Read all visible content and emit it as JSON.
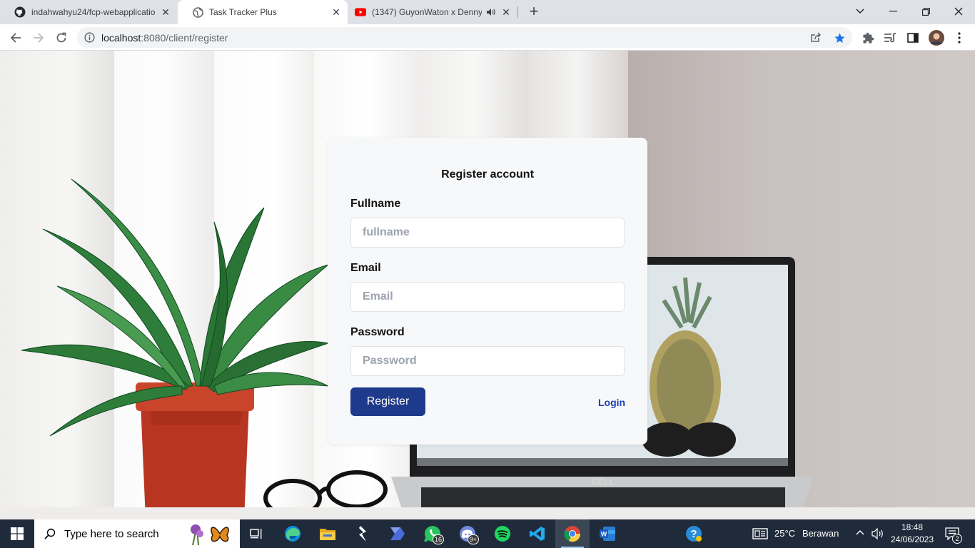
{
  "browser": {
    "tabs": [
      {
        "title": "indahwahyu24/fcp-webapplicatio",
        "icon": "github-icon"
      },
      {
        "title": "Task Tracker Plus",
        "icon": "globe-icon"
      },
      {
        "title": "(1347) GuyonWaton x Denny",
        "icon": "youtube-icon",
        "audio": "speaker-icon"
      }
    ],
    "url_host": "localhost",
    "url_path": ":8080/client/register"
  },
  "form": {
    "title": "Register account",
    "fullname_label": "Fullname",
    "fullname_placeholder": "fullname",
    "email_label": "Email",
    "email_placeholder": "Email",
    "password_label": "Password",
    "password_placeholder": "Password",
    "register_label": "Register",
    "login_label": "Login"
  },
  "colors": {
    "primary_button": "#1e3a8a",
    "link": "#1e40af",
    "card_bg": "#f7f8fa",
    "taskbar_bg": "#1f2b3a"
  },
  "taskbar": {
    "search_placeholder": "Type here to search",
    "whatsapp_badge": "16",
    "discord_badge": "9+",
    "weather_temp": "25°C",
    "weather_desc": "Berawan",
    "time": "18:48",
    "date": "24/06/2023",
    "notifications": "2"
  }
}
